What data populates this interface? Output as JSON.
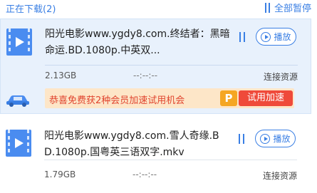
{
  "header": {
    "title": "正在下载(2)",
    "pause_all_label": "全部暂停"
  },
  "tasks": [
    {
      "name": "阳光电影www.ygdy8.com.终结者：黑暗命运.BD.1080p.中英双...",
      "size": "2.13GB",
      "speed": "--:--:--",
      "status": "连接资源",
      "play_label": "播放",
      "icon": "video-file-icon"
    },
    {
      "name": "阳光电影www.ygdy8.com.雪人奇缘.BD.1080p.国粤英三语双字.mkv",
      "size": "1.79GB",
      "speed": "--:--:--",
      "status": "连接资源",
      "play_label": "播放",
      "icon": "video-file-icon"
    }
  ],
  "promo": {
    "text": "恭喜免费获2种会员加速试用机会",
    "badge": "P",
    "button_label": "试用加速"
  },
  "colors": {
    "accent": "#3a7fe4",
    "promo_bg": "#fde6c8",
    "promo_text": "#e0442e",
    "promo_button": "#ef4a3a",
    "active_row_bg": "#e8f1fc"
  }
}
